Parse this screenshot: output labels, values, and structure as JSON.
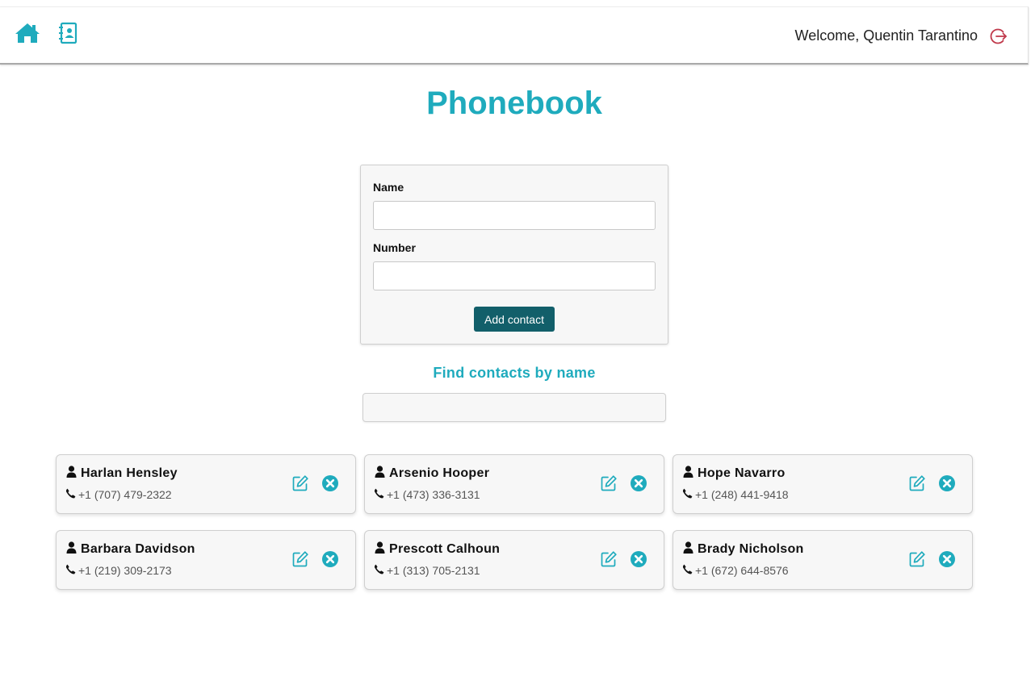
{
  "header": {
    "welcome_text": "Welcome, Quentin Tarantino",
    "icons": {
      "home": "home-icon",
      "contacts": "address-book-icon",
      "logout": "logout-icon"
    }
  },
  "page": {
    "title": "Phonebook"
  },
  "form": {
    "name_label": "Name",
    "name_value": "",
    "number_label": "Number",
    "number_value": "",
    "submit_label": "Add contact"
  },
  "filter": {
    "title": "Find contacts by name",
    "value": ""
  },
  "contacts": [
    {
      "name": "Harlan Hensley",
      "number": "+1 (707) 479-2322"
    },
    {
      "name": "Arsenio Hooper",
      "number": "+1 (473) 336-3131"
    },
    {
      "name": "Hope Navarro",
      "number": "+1 (248) 441-9418"
    },
    {
      "name": "Barbara Davidson",
      "number": "+1 (219) 309-2173"
    },
    {
      "name": "Prescott Calhoun",
      "number": "+1 (313) 705-2131"
    },
    {
      "name": "Brady Nicholson",
      "number": "+1 (672) 644-8576"
    }
  ],
  "colors": {
    "accent": "#1fabbd",
    "button": "#125f6a",
    "logout": "#c0394b"
  }
}
